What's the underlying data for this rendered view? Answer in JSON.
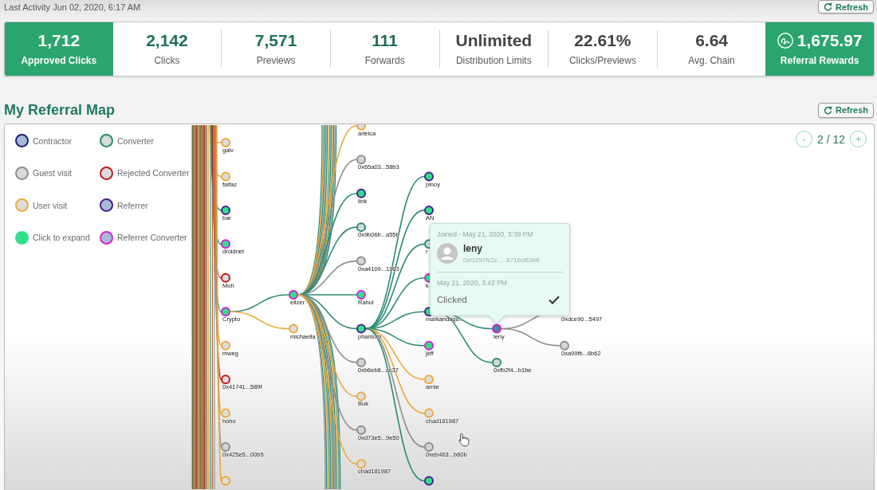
{
  "header": {
    "last_activity": "Last Activity Jun 02, 2020, 6:17 AM",
    "refresh_button": "Refresh"
  },
  "stats": [
    {
      "value": "1,712",
      "label": "Approved Clicks",
      "kind": "highlight"
    },
    {
      "value": "2,142",
      "label": "Clicks",
      "kind": "count"
    },
    {
      "value": "7,571",
      "label": "Previews",
      "kind": "count"
    },
    {
      "value": "111",
      "label": "Forwards",
      "kind": "count"
    },
    {
      "value": "Unlimited",
      "label": "Distribution Limits",
      "kind": "metric"
    },
    {
      "value": "22.61%",
      "label": "Clicks/Previews",
      "kind": "metric"
    },
    {
      "value": "6.64",
      "label": "Avg. Chain",
      "kind": "metric"
    },
    {
      "value": "1,675.97",
      "label": "Referral Rewards",
      "kind": "reward"
    }
  ],
  "referral_map": {
    "title": "My Referral Map",
    "refresh_button": "Refresh",
    "legend": [
      {
        "label": "Contractor",
        "kind": "contractor"
      },
      {
        "label": "Converter",
        "kind": "converter"
      },
      {
        "label": "Guest visit",
        "kind": "guest"
      },
      {
        "label": "Rejected Converter",
        "kind": "rejected"
      },
      {
        "label": "User visit",
        "kind": "user"
      },
      {
        "label": "Referrer",
        "kind": "referrer"
      },
      {
        "label": "Click to expand",
        "kind": "expandable"
      },
      {
        "label": "Referrer Converter",
        "kind": "referrer_converter"
      }
    ],
    "pager": {
      "previous": "-",
      "page": "2 / 12",
      "next": "+"
    },
    "nodes": [
      {
        "label": "galv",
        "kind": "user",
        "expandable": false,
        "selected": false
      },
      {
        "label": "faifaz",
        "kind": "user",
        "expandable": false,
        "selected": false
      },
      {
        "label": "bar",
        "kind": "referrer",
        "expandable": true,
        "selected": false
      },
      {
        "label": "droidnet",
        "kind": "referrer_converter",
        "expandable": true,
        "selected": false
      },
      {
        "label": "Moh",
        "kind": "rejected",
        "expandable": false,
        "selected": false
      },
      {
        "label": "Crypto",
        "kind": "referrer_converter",
        "expandable": true,
        "selected": false,
        "children": [
          {
            "label": "elizer",
            "kind": "referrer_converter",
            "expandable": true,
            "selected": false,
            "children": [
              {
                "label": "arielca",
                "kind": "user",
                "expandable": false,
                "selected": false
              },
              {
                "label": "0x65a03...58b3",
                "kind": "guest",
                "expandable": false,
                "selected": false
              },
              {
                "label": "link",
                "kind": "referrer",
                "expandable": true,
                "selected": false
              },
              {
                "label": "0x9b06b...a55b",
                "kind": "converter",
                "expandable": false,
                "selected": false
              },
              {
                "label": "0xa4109...1963",
                "kind": "guest",
                "expandable": false,
                "selected": false
              },
              {
                "label": "Rahul",
                "kind": "referrer_converter",
                "expandable": true,
                "selected": false
              },
              {
                "label": "phantom",
                "kind": "referrer",
                "expandable": true,
                "selected": false,
                "children": [
                  {
                    "label": "pinoy",
                    "kind": "referrer",
                    "expandable": true,
                    "selected": false
                  },
                  {
                    "label": "AN",
                    "kind": "referrer",
                    "expandable": true,
                    "selected": false
                  },
                  {
                    "label": "r",
                    "kind": "converter",
                    "expandable": false,
                    "selected": false
                  },
                  {
                    "label": "k",
                    "kind": "referrer_converter",
                    "expandable": true,
                    "selected": false
                  },
                  {
                    "label": "markandaqu...",
                    "kind": "referrer",
                    "expandable": true,
                    "selected": false,
                    "children": [
                      {
                        "label": "leny",
                        "kind": "referrer_converter",
                        "expandable": false,
                        "selected": true,
                        "children": [
                          {
                            "label": "0xdce90...5497",
                            "kind": "guest"
                          },
                          {
                            "label": "0xa99fb...6b62",
                            "kind": "guest",
                            "expandable": false,
                            "selected": false
                          }
                        ]
                      },
                      {
                        "label": "0xfb2f4...b1be",
                        "kind": "converter",
                        "expandable": false,
                        "selected": false
                      }
                    ]
                  },
                  {
                    "label": "jeff",
                    "kind": "referrer_converter",
                    "expandable": true,
                    "selected": false
                  },
                  {
                    "label": "arnie",
                    "kind": "user",
                    "expandable": false,
                    "selected": false
                  },
                  {
                    "label": "chad181987",
                    "kind": "user",
                    "expandable": false,
                    "selected": false
                  },
                  {
                    "label": "0xeb463...b60b",
                    "kind": "guest",
                    "expandable": false,
                    "selected": false
                  },
                  {
                    "kind": "referrer",
                    "expandable": true,
                    "selected": false
                  }
                ]
              },
              {
                "label": "0xb6eb8...cc37",
                "kind": "guest",
                "expandable": false,
                "selected": false
              },
              {
                "label": "Buk",
                "kind": "user",
                "expandable": false,
                "selected": false
              },
              {
                "label": "0xd73e5...9e50",
                "kind": "guest",
                "expandable": false,
                "selected": false
              },
              {
                "label": "chad181987",
                "kind": "user",
                "expandable": false,
                "selected": false
              }
            ]
          },
          {
            "label": "michaella",
            "kind": "user",
            "expandable": false,
            "selected": false
          }
        ]
      },
      {
        "label": "mweg",
        "kind": "user",
        "expandable": false,
        "selected": false
      },
      {
        "label": "0x41741...589f",
        "kind": "rejected",
        "expandable": false,
        "selected": false
      },
      {
        "label": "hoho",
        "kind": "user",
        "expandable": false,
        "selected": false
      },
      {
        "label": "0x425e5...00b5",
        "kind": "guest",
        "expandable": false,
        "selected": false
      },
      {
        "kind": "user",
        "expandable": false,
        "selected": false
      }
    ],
    "tooltip": {
      "joined": "Joined - May 21, 2020, 3:39 PM",
      "name": "leny",
      "address": "0xf1297fc2c.....6716cf63b6",
      "event_time": "May 21, 2020, 3:42 PM",
      "event": "Clicked",
      "checked": true
    }
  }
}
